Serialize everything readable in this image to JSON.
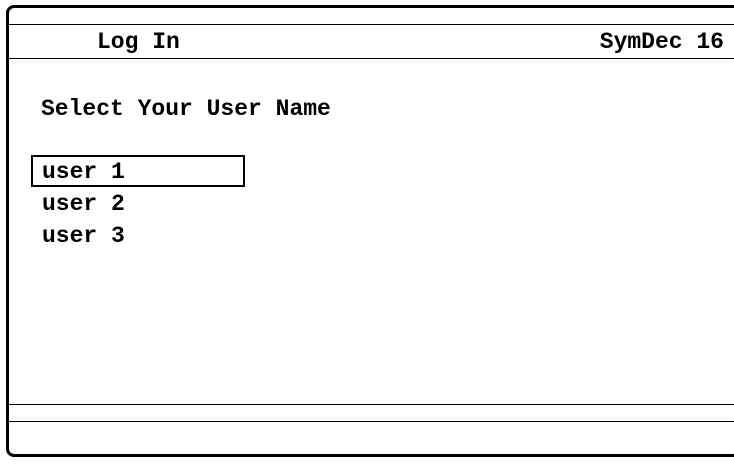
{
  "header": {
    "title": "Log In",
    "device_name": "SymDec 16"
  },
  "main": {
    "prompt": "Select Your User Name",
    "users": [
      {
        "label": "user 1",
        "selected": true
      },
      {
        "label": "user 2",
        "selected": false
      },
      {
        "label": "user 3",
        "selected": false
      }
    ]
  },
  "footer": {
    "status": ""
  },
  "colors": {
    "background": "#ffffff",
    "foreground": "#000000"
  }
}
